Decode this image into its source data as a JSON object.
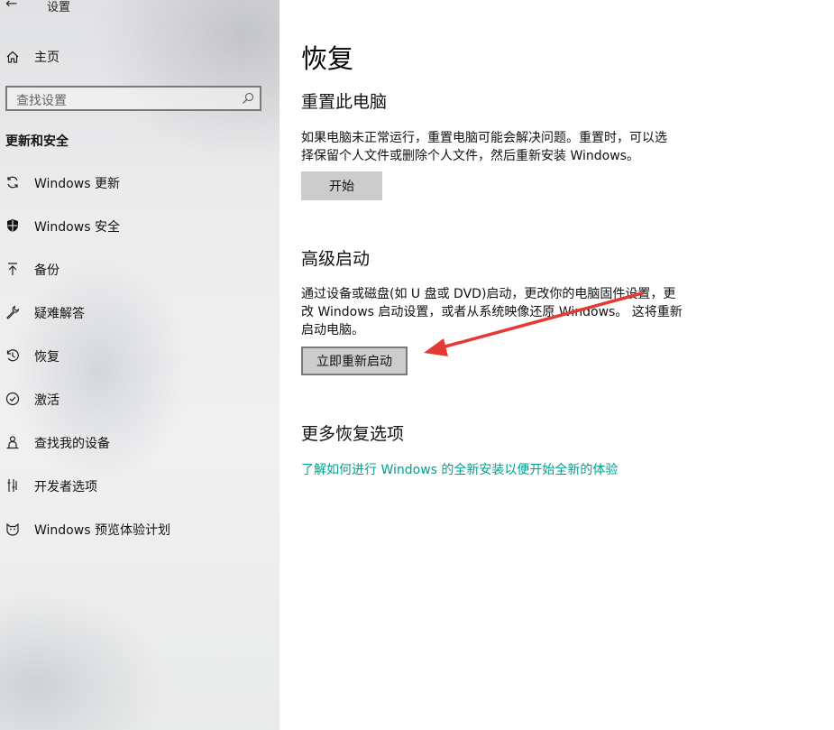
{
  "window": {
    "back_glyph": "←",
    "title": "设置"
  },
  "sidebar": {
    "home_label": "主页",
    "search_placeholder": "查找设置",
    "section_title": "更新和安全",
    "items": [
      {
        "label": "Windows 更新",
        "icon": "sync-icon"
      },
      {
        "label": "Windows 安全",
        "icon": "shield-icon"
      },
      {
        "label": "备份",
        "icon": "backup-arrow-icon"
      },
      {
        "label": "疑难解答",
        "icon": "wrench-icon"
      },
      {
        "label": "恢复",
        "icon": "history-icon"
      },
      {
        "label": "激活",
        "icon": "check-circle-icon"
      },
      {
        "label": "查找我的设备",
        "icon": "person-locate-icon"
      },
      {
        "label": "开发者选项",
        "icon": "developer-tools-icon"
      },
      {
        "label": "Windows 预览体验计划",
        "icon": "insider-cat-icon"
      }
    ]
  },
  "main": {
    "title": "恢复",
    "reset": {
      "heading": "重置此电脑",
      "line1": "如果电脑未正常运行，重置电脑可能会解决问题。重置时，可以选",
      "line2": "择保留个人文件或删除个人文件，然后重新安装 Windows。",
      "button": "开始"
    },
    "advanced": {
      "heading": "高级启动",
      "line1": "通过设备或磁盘(如 U 盘或 DVD)启动，更改你的电脑固件设置，更",
      "line2": "改 Windows 启动设置，或者从系统映像还原 Windows。 这将重新",
      "line3": "启动电脑。",
      "button": "立即重新启动"
    },
    "more": {
      "heading": "更多恢复选项",
      "link": "了解如何进行 Windows 的全新安装以便开始全新的体验"
    }
  },
  "colors": {
    "link": "#00a08a",
    "annotation_arrow": "#e53935",
    "button_bg": "#cccccc"
  }
}
